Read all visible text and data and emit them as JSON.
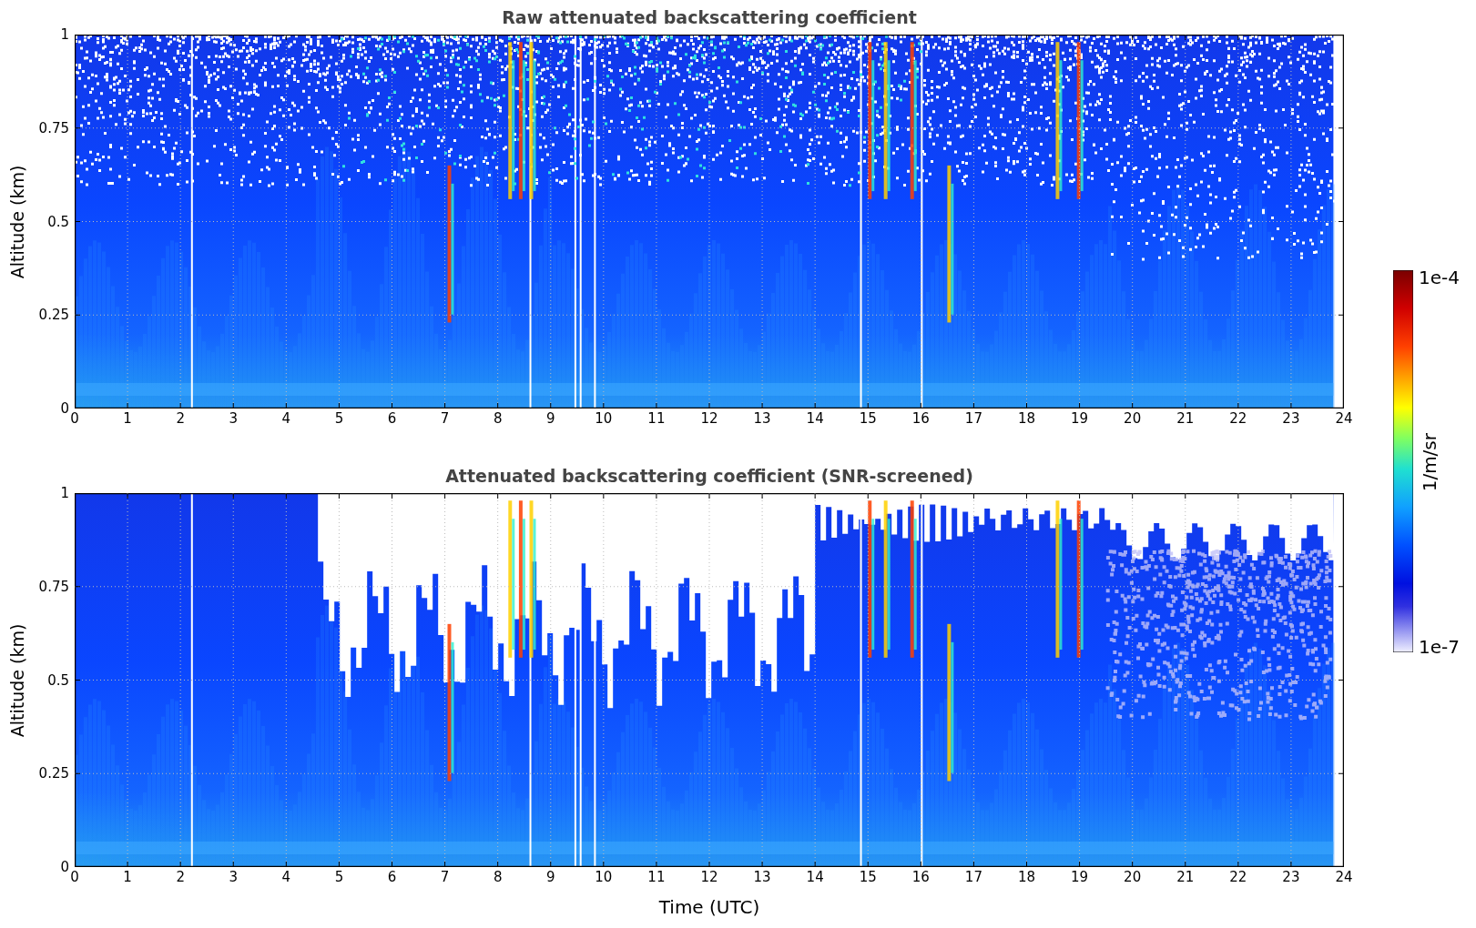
{
  "panels": [
    {
      "title": "Raw attenuated backscattering coefficient",
      "ylabel": "Altitude (km)",
      "screened": false,
      "yticks": [
        "1",
        "0.75",
        "0.5",
        "0.25",
        "0"
      ],
      "xticks": [
        "0",
        "1",
        "2",
        "3",
        "4",
        "5",
        "6",
        "7",
        "8",
        "9",
        "10",
        "11",
        "12",
        "13",
        "14",
        "15",
        "16",
        "17",
        "18",
        "19",
        "20",
        "21",
        "22",
        "23",
        "24"
      ]
    },
    {
      "title": "Attenuated backscattering coefficient (SNR-screened)",
      "ylabel": "Altitude (km)",
      "screened": true,
      "yticks": [
        "1",
        "0.75",
        "0.5",
        "0.25",
        "0"
      ],
      "xticks": [
        "0",
        "1",
        "2",
        "3",
        "4",
        "5",
        "6",
        "7",
        "8",
        "9",
        "10",
        "11",
        "12",
        "13",
        "14",
        "15",
        "16",
        "17",
        "18",
        "19",
        "20",
        "21",
        "22",
        "23",
        "24"
      ]
    }
  ],
  "xlabel": "Time (UTC)",
  "colorbar": {
    "max_label": "1e-4",
    "min_label": "1e-7",
    "label": "1/m/sr"
  }
}
